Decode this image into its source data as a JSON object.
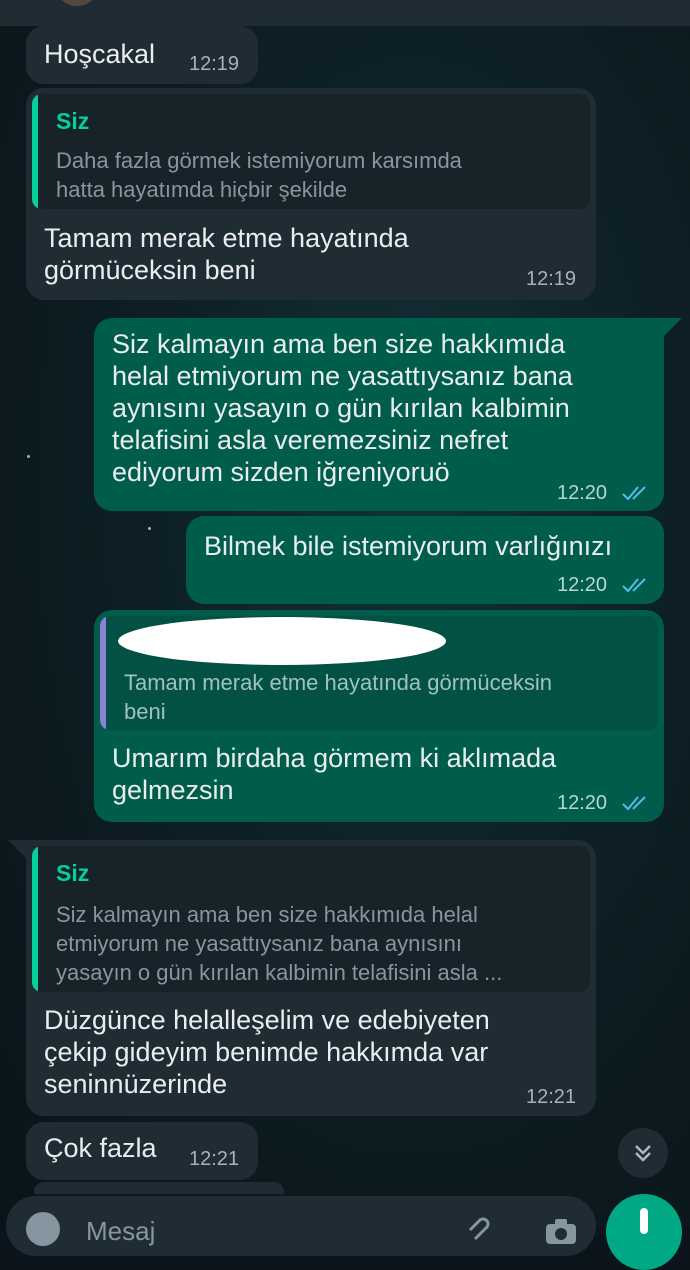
{
  "chat": {
    "messages": [
      {
        "id": "m1",
        "dir": "in",
        "text": "Hoşcakal",
        "time": "12:19"
      },
      {
        "id": "m2",
        "dir": "in",
        "quote": {
          "name": "Siz",
          "text": "Daha fazla görmek istemiyorum karsımda\nhatta hayatımda hiçbir şekilde"
        },
        "text": "Tamam merak etme hayatında\ngörmüceksin beni",
        "time": "12:19"
      },
      {
        "id": "m3",
        "dir": "out",
        "text": "Siz kalmayın ama ben size hakkımıda\nhelal etmiyorum ne yasattıysanız bana\naynısını yasayın o gün kırılan kalbimin\ntelafisini asla veremezsiniz nefret\nediyorum sizden iğreniyoruö",
        "time": "12:20",
        "status": "read"
      },
      {
        "id": "m4",
        "dir": "out",
        "text": "Bilmek bile istemiyorum varlığınızı",
        "time": "12:20",
        "status": "read"
      },
      {
        "id": "m5",
        "dir": "out",
        "quote": {
          "name": "",
          "text": "Tamam merak etme hayatında görmüceksin\nbeni"
        },
        "text": "Umarım birdaha görmem ki aklımada\ngelmezsin",
        "time": "12:20",
        "status": "read"
      },
      {
        "id": "m6",
        "dir": "in",
        "quote": {
          "name": "Siz",
          "text": "Siz kalmayın ama ben size hakkımıda helal\netmiyorum ne yasattıysanız bana aynısını\nyasayın o gün kırılan kalbimin telafisini asla ..."
        },
        "text": "Düzgünce helalleşelim ve edebiyeten\nçekip gideyim benimde hakkımda var\nseninnüzerinde",
        "time": "12:21"
      },
      {
        "id": "m7",
        "dir": "in",
        "text": "Çok fazla",
        "time": "12:21"
      }
    ]
  },
  "composer": {
    "placeholder": "Mesaj"
  },
  "icons": {
    "read_ticks": "double-check-icon",
    "scroll_down": "chevron-double-down-icon",
    "emoji": "emoji-icon",
    "attach": "paperclip-icon",
    "camera": "camera-icon",
    "mic": "microphone-icon"
  },
  "colors": {
    "incoming": "#1f2c34",
    "outgoing": "#005c4b",
    "accent": "#06cf9c",
    "ticks": "#53bdeb"
  }
}
